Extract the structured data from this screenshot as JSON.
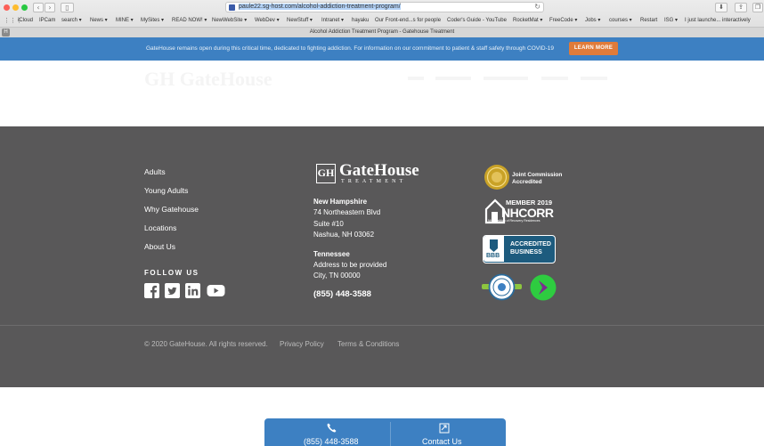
{
  "browser": {
    "url_selected": "paule22.sg-host.com/alcohol-addiction-treatment-program/",
    "tab_title": "Alcohol Addiction Treatment Program - Gatehouse Treatment",
    "bookmarks": [
      {
        "label": "iCloud"
      },
      {
        "label": "IPCam"
      },
      {
        "label": "search ▾"
      },
      {
        "label": "News ▾"
      },
      {
        "label": "MINE ▾"
      },
      {
        "label": "MySites ▾"
      },
      {
        "label": "READ NOW! ▾"
      },
      {
        "label": "NewWebSite ▾"
      },
      {
        "label": "WebDev ▾"
      },
      {
        "label": "NewStuff ▾"
      },
      {
        "label": "Intranet ▾"
      },
      {
        "label": "hayaku"
      },
      {
        "label": "Our Front-end...s for people"
      },
      {
        "label": "Coder's Guide - YouTube"
      },
      {
        "label": "RocketMat ▾"
      },
      {
        "label": "FreeCode ▾"
      },
      {
        "label": "Jobs ▾"
      },
      {
        "label": "courses ▾"
      },
      {
        "label": "Restart"
      },
      {
        "label": "ISG ▾"
      },
      {
        "label": "I just launche... interactively"
      }
    ]
  },
  "banner": {
    "message": "GateHouse remains open during this critical time, dedicated to fighting addiction. For information on our commitment to patient & staff safety through COVID-19",
    "button": "LEARN MORE"
  },
  "footer": {
    "nav": [
      {
        "label": "Adults"
      },
      {
        "label": "Young Adults"
      },
      {
        "label": "Why Gatehouse"
      },
      {
        "label": "Locations"
      },
      {
        "label": "About Us"
      }
    ],
    "follow_label": "FOLLOW US",
    "logo": {
      "mark": "GH",
      "name": "GateHouse",
      "sub": "TREATMENT"
    },
    "nh": {
      "state": "New Hampshire",
      "line1": "74 Northeastern Blvd",
      "line2": "Suite #10",
      "line3": "Nashua, NH 03062"
    },
    "tn": {
      "state": "Tennessee",
      "line1": "Address to be provided",
      "line2": "City, TN 00000"
    },
    "phone": "(855) 448-3588",
    "badges": {
      "joint_commission": "Joint Commission Accredited",
      "nhcorr_member": "MEMBER 2019",
      "nhcorr": "NHCORR",
      "nhcorr_sub": "NH Coalition of Recovery Residences",
      "bbb": "BBB",
      "bbb_text": "ACCREDITED BUSINESS"
    },
    "copyright": "© 2020 GateHouse. All rights reserved.",
    "privacy": "Privacy Policy",
    "terms": "Terms & Conditions"
  },
  "contact_bar": {
    "phone_label": "(855) 448-3588",
    "contact_label": "Contact Us"
  },
  "colors": {
    "banner_blue": "#3d80c2",
    "footer_gray": "#595859",
    "learn_more_orange": "#e07b39"
  }
}
